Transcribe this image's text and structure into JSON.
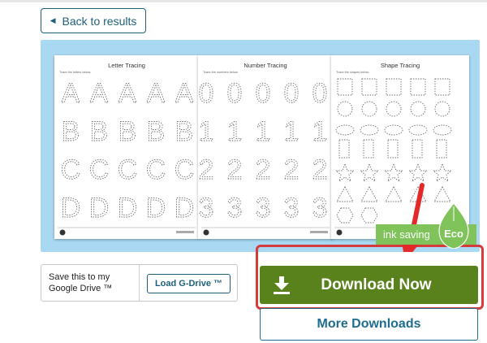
{
  "nav": {
    "back_label": "Back to results"
  },
  "preview": {
    "sheets": [
      {
        "title": "Letter Tracing",
        "subtitle": "Trace the letters below.",
        "rows": [
          "A",
          "B",
          "C",
          "D"
        ]
      },
      {
        "title": "Number Tracing",
        "subtitle": "Trace the numbers below.",
        "rows": [
          "0",
          "1",
          "2",
          "3"
        ]
      },
      {
        "title": "Shape Tracing",
        "subtitle": "Trace the shapes below."
      }
    ],
    "eco_badge": {
      "label": "ink saving",
      "leaf_label": "Eco"
    }
  },
  "gdrive": {
    "text": "Save this to my Google Drive ™",
    "button_label": "Load G-Drive ™"
  },
  "actions": {
    "download_label": "Download Now",
    "more_label": "More Downloads"
  },
  "colors": {
    "accent": "#1f5f7a",
    "download_green": "#5a821c",
    "eco_green": "#7fc35a",
    "highlight_red": "#d63b3b",
    "preview_bg": "#a9d9f2"
  },
  "icons": {
    "back": "left-triangle-icon",
    "download": "download-icon",
    "eco": "leaf-icon",
    "annotation": "red-arrow"
  }
}
